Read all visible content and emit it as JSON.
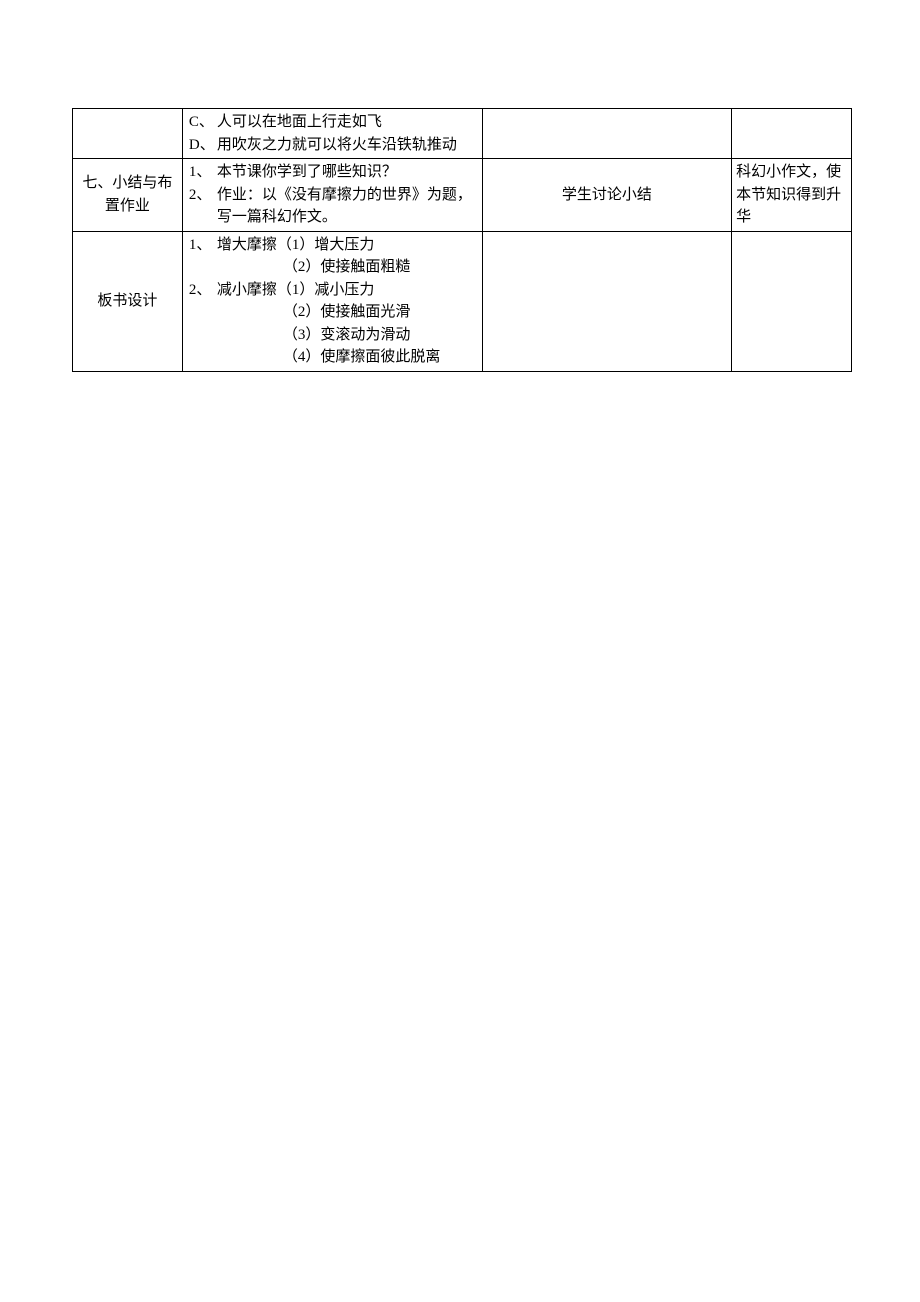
{
  "rows": [
    {
      "col1": "",
      "col2_lines": [
        {
          "marker": "C、",
          "text": "人可以在地面上行走如飞",
          "indent": 0
        },
        {
          "marker": "D、",
          "text": "用吹灰之力就可以将火车沿铁轨推动",
          "indent": 0
        }
      ],
      "col3": "",
      "col4": ""
    },
    {
      "col1": "七、小结与布置作业",
      "col2_lines": [
        {
          "marker": "1、",
          "text": "本节课你学到了哪些知识？",
          "indent": 0
        },
        {
          "marker": "2、",
          "text": "作业：以《没有摩擦力的世界》为题，写一篇科幻作文。",
          "indent": 0
        }
      ],
      "col3": "学生讨论小结",
      "col4": "科幻小作文，使本节知识得到升华"
    },
    {
      "col1": "板书设计",
      "col2_lines": [
        {
          "marker": "1、",
          "text": "增大摩擦（1）增大压力",
          "indent": 0
        },
        {
          "marker": "",
          "text": "（2）使接触面粗糙",
          "indent": 1
        },
        {
          "marker": "2、",
          "text": "减小摩擦（1）减小压力",
          "indent": 0
        },
        {
          "marker": "",
          "text": "（2）使接触面光滑",
          "indent": 1
        },
        {
          "marker": "",
          "text": "（3）变滚动为滑动",
          "indent": 1
        },
        {
          "marker": "",
          "text": "（4）使摩擦面彼此脱离",
          "indent": 1
        }
      ],
      "col3": "",
      "col4": ""
    }
  ]
}
